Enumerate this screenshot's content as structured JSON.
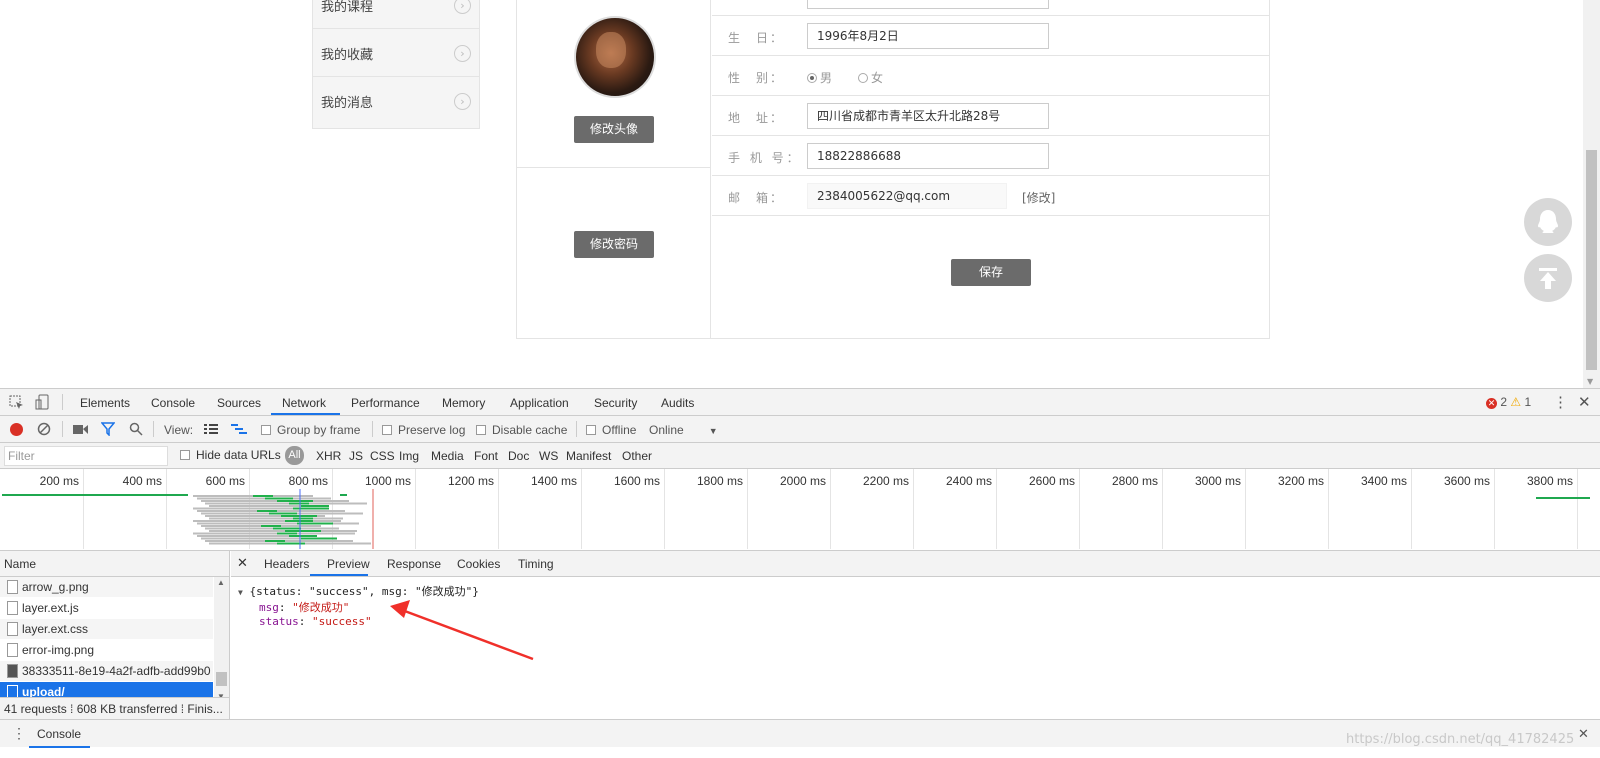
{
  "menu": {
    "items": [
      {
        "label": "我的课程"
      },
      {
        "label": "我的收藏"
      },
      {
        "label": "我的消息"
      }
    ]
  },
  "profile": {
    "change_avatar": "修改头像",
    "change_password": "修改密码",
    "save": "保存",
    "birthday": {
      "label": "生　日：",
      "value": "1996年8月2日"
    },
    "gender": {
      "label": "性　别：",
      "options": [
        "男",
        "女"
      ],
      "selected": "男"
    },
    "address": {
      "label": "地　址：",
      "value": "四川省成都市青羊区太升北路28号"
    },
    "phone": {
      "label": "手 机 号：",
      "value": "18822886688"
    },
    "email": {
      "label": "邮　箱：",
      "value": "2384005622@qq.com",
      "edit": "[修改]"
    }
  },
  "devtools": {
    "tabs": [
      "Elements",
      "Console",
      "Sources",
      "Network",
      "Performance",
      "Memory",
      "Application",
      "Security",
      "Audits"
    ],
    "active_tab": "Network",
    "errors": "2",
    "warnings": "1",
    "toolbar": {
      "view": "View:",
      "group_by_frame": "Group by frame",
      "preserve_log": "Preserve log",
      "disable_cache": "Disable cache",
      "offline": "Offline",
      "throttle": "Online"
    },
    "filter": {
      "placeholder": "Filter",
      "hide_data_urls": "Hide data URLs",
      "types": [
        "All",
        "XHR",
        "JS",
        "CSS",
        "Img",
        "Media",
        "Font",
        "Doc",
        "WS",
        "Manifest",
        "Other"
      ]
    },
    "timeline_ticks": [
      "200 ms",
      "400 ms",
      "600 ms",
      "800 ms",
      "1000 ms",
      "1200 ms",
      "1400 ms",
      "1600 ms",
      "1800 ms",
      "2000 ms",
      "2200 ms",
      "2400 ms",
      "2600 ms",
      "2800 ms",
      "3000 ms",
      "3200 ms",
      "3400 ms",
      "3600 ms",
      "3800 ms"
    ],
    "name_header": "Name",
    "requests": [
      {
        "name": "arrow_g.png"
      },
      {
        "name": "layer.ext.js"
      },
      {
        "name": "layer.ext.css"
      },
      {
        "name": "error-img.png"
      },
      {
        "name": "38333511-8e19-4a2f-adfb-add99b0"
      },
      {
        "name": "upload/"
      }
    ],
    "status": "41 requests ⁞ 608 KB transferred ⁞ Finis...",
    "detail_tabs": [
      "Headers",
      "Preview",
      "Response",
      "Cookies",
      "Timing"
    ],
    "active_detail_tab": "Preview",
    "preview": {
      "summary": "{status: \"success\", msg: \"修改成功\"}",
      "msg_key": "msg",
      "msg_value": "\"修改成功\"",
      "status_key": "status",
      "status_value": "\"success\""
    },
    "drawer_tab": "Console"
  },
  "watermark": "https://blog.csdn.net/qq_41782425",
  "colors": {
    "accent": "#1a73e8",
    "record": "#d93025",
    "button_gray": "#6b6b6b",
    "arrow": "#f0302a"
  }
}
